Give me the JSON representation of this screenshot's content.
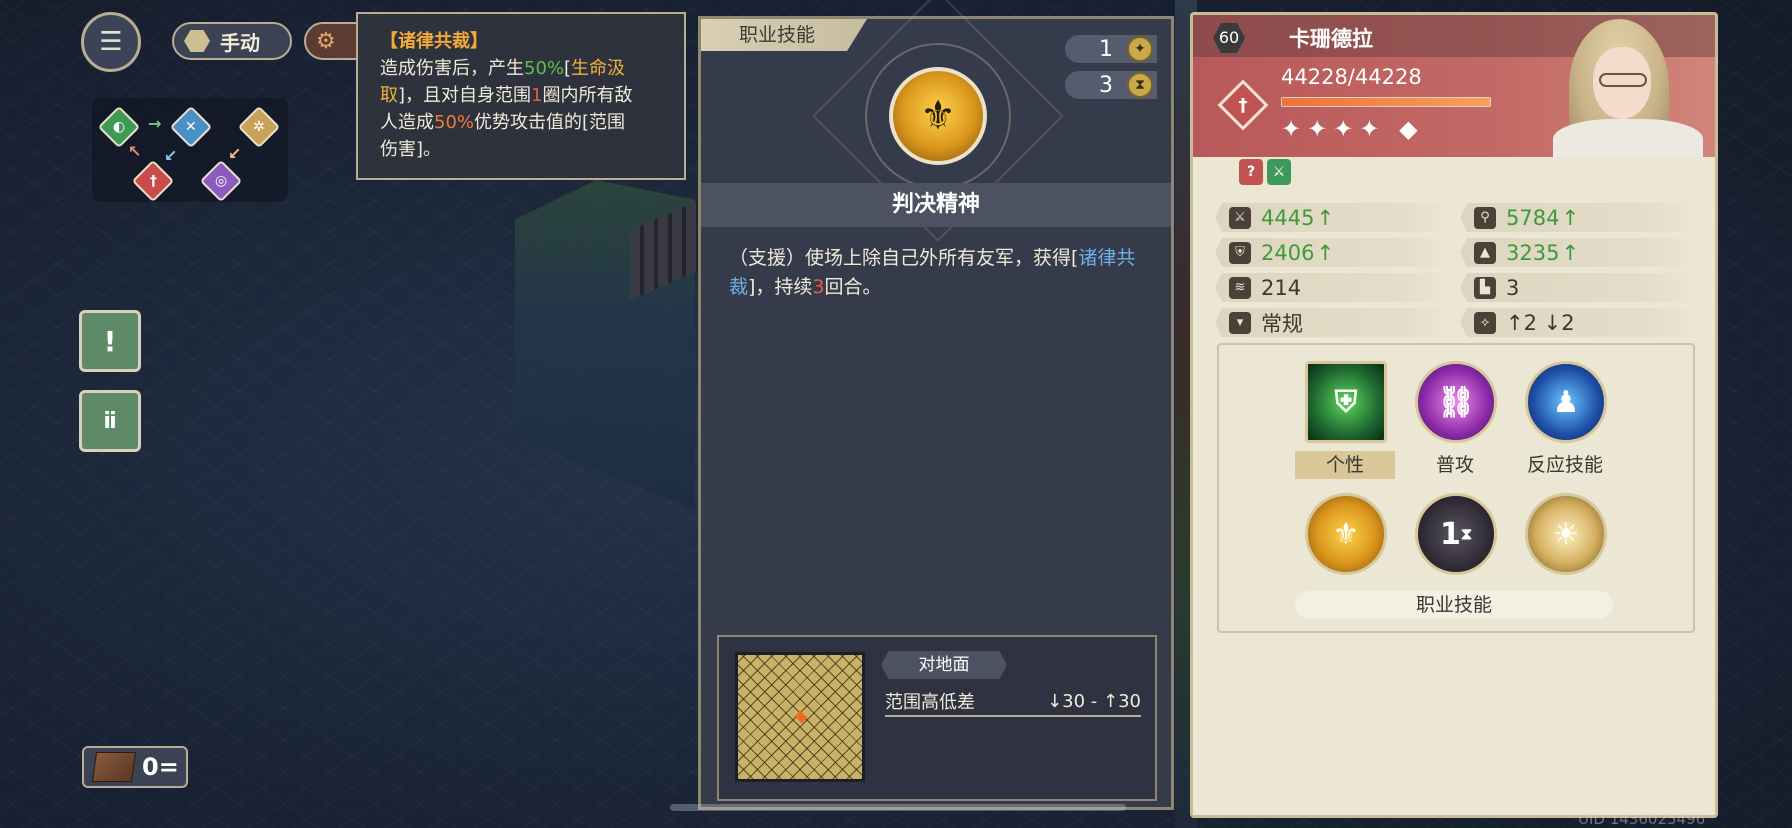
{
  "hud": {
    "mode_label": "手动",
    "menu_icon": "hamburger-menu-icon",
    "auto_icon": "gear-icon",
    "block_count": "0="
  },
  "tooltip": {
    "title": "【诸律共裁】",
    "l1a": "造成伤害后，产生",
    "l1b": "50%",
    "l1c": "[",
    "l1d": "生命汲",
    "l2a": "取",
    "l2b": "]，且对自身范围",
    "l2c": "1",
    "l2d": "圈内所有敌",
    "l3a": "人造成",
    "l3b": "50%",
    "l3c": "优势攻击值的[范围",
    "l4": "伤害]。"
  },
  "skill_panel": {
    "tab_label": "职业技能",
    "cost1": "1",
    "cost2": "3",
    "skill_name": "判决精神",
    "desc_a": "（支援）使场上除自己外所有友军，获得[",
    "desc_b": "诸律共裁",
    "desc_c": "]，持续",
    "desc_d": "3",
    "desc_e": "回合。",
    "ground_label": "对地面",
    "height_label": "范围高低差",
    "height_value": "↓30 - ↑30"
  },
  "character": {
    "level": "60",
    "name": "卡珊德拉",
    "hp": "44228/44228",
    "hp_fraction": 1.0,
    "stars": "✦✦✦✦ ◆",
    "stats": [
      {
        "icon": "sword-icon",
        "value": "4445",
        "arrow": "↑",
        "up": true
      },
      {
        "icon": "staff-icon",
        "value": "5784",
        "arrow": "↑",
        "up": true
      },
      {
        "icon": "shield-icon",
        "value": "2406",
        "arrow": "↑",
        "up": true
      },
      {
        "icon": "wizard-hat-icon",
        "value": "3235",
        "arrow": "↑",
        "up": true
      },
      {
        "icon": "wing-icon",
        "value": "214",
        "arrow": "",
        "up": false
      },
      {
        "icon": "boot-icon",
        "value": "3",
        "arrow": "",
        "up": false
      },
      {
        "icon": "move-type-icon",
        "value": "常规",
        "arrow": "",
        "up": false
      },
      {
        "icon": "jump-icon",
        "value": "↑2 ↓2",
        "arrow": "",
        "up": false
      }
    ],
    "skill_labels": {
      "trait": "个性",
      "normal_attack": "普攻",
      "reaction": "反应技能",
      "class_skill": "职业技能"
    },
    "class_skill_cooldown": "1"
  },
  "footer": {
    "uid": "UID 1436025496"
  }
}
